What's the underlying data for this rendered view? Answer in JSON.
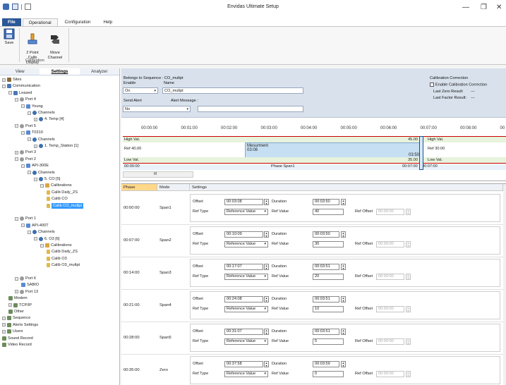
{
  "window": {
    "title": "Envidas Ultimate Setup",
    "controls": [
      "—",
      "❐",
      "✕"
    ]
  },
  "ribbon_tabs": [
    "File",
    "Operational",
    "Configuration",
    "Help"
  ],
  "ribbon": {
    "save": "Save",
    "two_point_calib": "2 Point Calib\nDisplay",
    "move_channel": "Move\nChannel",
    "group_label": "Calibration"
  },
  "left_tabs": [
    "View",
    "Settings",
    "Analyzer"
  ],
  "tree": [
    {
      "label": "Sites",
      "depth": 0,
      "exp": "+",
      "icon": "site"
    },
    {
      "label": "Communication",
      "depth": 0,
      "exp": "−",
      "icon": "comm"
    },
    {
      "label": "Leased",
      "depth": 1,
      "exp": "−",
      "icon": "comm"
    },
    {
      "label": "Port 4",
      "depth": 2,
      "exp": "−",
      "icon": "port"
    },
    {
      "label": "Young",
      "depth": 3,
      "exp": "−",
      "icon": "dev"
    },
    {
      "label": "Channels",
      "depth": 4,
      "exp": "−",
      "icon": "ch"
    },
    {
      "label": "4. Temp [4]",
      "depth": 5,
      "exp": "+",
      "icon": "ch"
    },
    {
      "label": "Port 5",
      "depth": 2,
      "exp": "−",
      "icon": "port"
    },
    {
      "label": "T0310",
      "depth": 3,
      "exp": "−",
      "icon": "dev"
    },
    {
      "label": "Channels",
      "depth": 4,
      "exp": "−",
      "icon": "ch"
    },
    {
      "label": "1. Temp_Station [1]",
      "depth": 5,
      "exp": "+",
      "icon": "ch"
    },
    {
      "label": "Port 3",
      "depth": 2,
      "exp": "+",
      "icon": "port"
    },
    {
      "label": "Port 2",
      "depth": 2,
      "exp": "−",
      "icon": "port"
    },
    {
      "label": "API-300E",
      "depth": 3,
      "exp": "−",
      "icon": "dev"
    },
    {
      "label": "Channels",
      "depth": 4,
      "exp": "−",
      "icon": "ch"
    },
    {
      "label": "5. CO [5]",
      "depth": 5,
      "exp": "−",
      "icon": "ch"
    },
    {
      "label": "Calibrations",
      "depth": 6,
      "exp": "−",
      "icon": "cal"
    },
    {
      "label": "Calib Daily_ZS",
      "depth": 7,
      "exp": "",
      "icon": "file"
    },
    {
      "label": "Calib CO",
      "depth": 7,
      "exp": "",
      "icon": "file"
    },
    {
      "label": "Calib CO_multpt",
      "depth": 7,
      "exp": "",
      "icon": "file",
      "selected": true
    },
    {
      "label": "",
      "depth": 0,
      "exp": "",
      "icon": ""
    },
    {
      "label": "Port 1",
      "depth": 2,
      "exp": "−",
      "icon": "port"
    },
    {
      "label": "API-400T",
      "depth": 3,
      "exp": "−",
      "icon": "dev"
    },
    {
      "label": "Channels",
      "depth": 4,
      "exp": "−",
      "icon": "ch"
    },
    {
      "label": "6. O3 [6]",
      "depth": 5,
      "exp": "−",
      "icon": "ch"
    },
    {
      "label": "Calibrations",
      "depth": 6,
      "exp": "−",
      "icon": "cal"
    },
    {
      "label": "Calib Daily_ZS",
      "depth": 7,
      "exp": "",
      "icon": "file"
    },
    {
      "label": "Calib O3",
      "depth": 7,
      "exp": "",
      "icon": "file"
    },
    {
      "label": "Calib O3_multpt",
      "depth": 7,
      "exp": "",
      "icon": "file"
    },
    {
      "label": "",
      "depth": 0,
      "exp": "",
      "icon": ""
    },
    {
      "label": "Port 6",
      "depth": 2,
      "exp": "−",
      "icon": "port"
    },
    {
      "label": "SABIO",
      "depth": 3,
      "exp": "",
      "icon": "dev"
    },
    {
      "label": "Port 13",
      "depth": 2,
      "exp": "+",
      "icon": "port"
    },
    {
      "label": "Modem",
      "depth": 1,
      "exp": "",
      "icon": "misc"
    },
    {
      "label": "TCP/IP",
      "depth": 1,
      "exp": "+",
      "icon": "misc"
    },
    {
      "label": "Other",
      "depth": 1,
      "exp": "",
      "icon": "misc"
    },
    {
      "label": "Sequence",
      "depth": 0,
      "exp": "+",
      "icon": "misc"
    },
    {
      "label": "Alerts Settings",
      "depth": 0,
      "exp": "+",
      "icon": "misc"
    },
    {
      "label": "Users",
      "depth": 0,
      "exp": "+",
      "icon": "misc"
    },
    {
      "label": "Sound Record",
      "depth": 0,
      "exp": "",
      "icon": "misc"
    },
    {
      "label": "Video Record",
      "depth": 0,
      "exp": "",
      "icon": "misc"
    }
  ],
  "props": {
    "belongs_to": "Belongs to Sequence : CO_multpt",
    "enable_label": "Enable",
    "enable_value": "On",
    "name_label": "Name",
    "name_value": "CO_multpt",
    "send_alert_label": "Send Alert",
    "send_alert_value": "No",
    "alert_message_label": "Alert Message :",
    "alert_message_value": "",
    "calib_correction_title": "Calibration Correction",
    "enable_calib_correction": "Enable Calibration Correction",
    "last_zero": "Last Zero Result:",
    "last_zero_val": "---",
    "last_factor": "Last Factor Result:",
    "last_factor_val": "---"
  },
  "timeline": {
    "ticks": [
      "00:00:00",
      "00:01:00",
      "00:02:00",
      "00:03:00",
      "00:04:00",
      "00:05:00",
      "00:06:00",
      "00:07:00",
      "00:08:00",
      "00"
    ],
    "high_label": "High Val.",
    "high_right": "45.00",
    "high_label2": "High Val.",
    "ref_label": "Ref 40.00",
    "ref_label2": "Ref 30.00",
    "measurement": "Mesurment",
    "measurement_time": "03:08",
    "measurement_end": "03:50",
    "low_label": "Low Val.",
    "low_right": "35.00",
    "low_label2": "Low Val.",
    "ts_start": "00:00:00",
    "phase_span": "Phase Span1",
    "ts_end": "00:07:00",
    "ts_end2": "00:07:00",
    "scroll_label": "III"
  },
  "grid": {
    "headers": [
      "Phase",
      "Mode",
      "Settings"
    ],
    "labels": {
      "offset": "Offset",
      "duration": "Duration",
      "ref_type": "Ref Type",
      "ref_value": "Ref Value",
      "ref_offset": "Ref Offset"
    },
    "rows": [
      {
        "phase": "00:00:00",
        "mode": "Span1",
        "offset": "00:03:08",
        "duration": "00:03:50",
        "ref_type": "Reference Value",
        "ref_value": "40",
        "ref_offset": "00:00:00"
      },
      {
        "phase": "00:07:00",
        "mode": "Span2",
        "offset": "00:10:09",
        "duration": "00:03:50",
        "ref_type": "Reference Value",
        "ref_value": "30",
        "ref_offset": "00:00:00"
      },
      {
        "phase": "00:14:00",
        "mode": "Span3",
        "offset": "00:17:07",
        "duration": "00:03:51",
        "ref_type": "Reference Value",
        "ref_value": "20",
        "ref_offset": "00:00:00"
      },
      {
        "phase": "00:21:00",
        "mode": "Span4",
        "offset": "00:24:08",
        "duration": "00:03:51",
        "ref_type": "Reference Value",
        "ref_value": "10",
        "ref_offset": "00:00:00"
      },
      {
        "phase": "00:28:00",
        "mode": "Span5",
        "offset": "00:31:07",
        "duration": "00:03:51",
        "ref_type": "Reference Value",
        "ref_value": "5",
        "ref_offset": "00:00:00"
      },
      {
        "phase": "00:35:00",
        "mode": "Zero",
        "offset": "00:37:58",
        "duration": "00:03:59",
        "ref_type": "Reference Value",
        "ref_value": "0",
        "ref_offset": "00:00:00"
      }
    ]
  }
}
